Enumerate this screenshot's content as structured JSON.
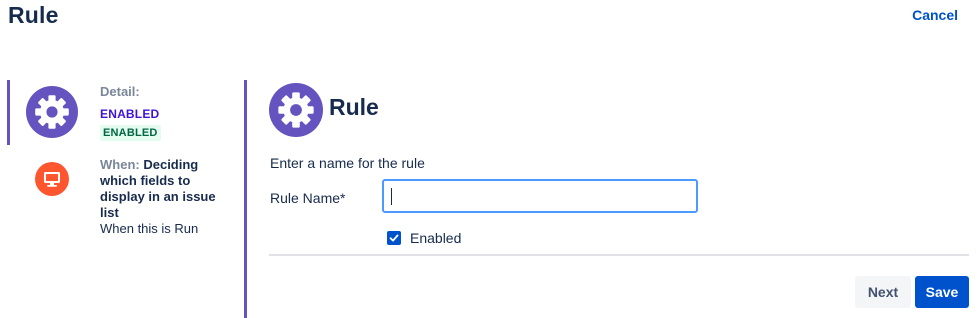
{
  "header": {
    "title": "Rule",
    "cancel_label": "Cancel"
  },
  "sidebar": {
    "detail": {
      "label": "Detail:",
      "status": "ENABLED",
      "lozenge": "ENABLED"
    },
    "when": {
      "label": "When:",
      "title": "Deciding which fields to display in an issue list",
      "subtitle": "When this is Run"
    }
  },
  "main": {
    "title": "Rule",
    "instruction": "Enter a name for the rule",
    "rule_name": {
      "label": "Rule Name*",
      "value": "",
      "placeholder": ""
    },
    "enabled": {
      "label": "Enabled",
      "checked": true
    },
    "buttons": {
      "next": "Next",
      "save": "Save"
    }
  },
  "colors": {
    "accent_purple": "#6554c0",
    "accent_orange": "#ff5630",
    "primary_blue": "#0052cc",
    "success_green": "#006644",
    "focus_blue": "#4c9aff"
  },
  "icons": {
    "detail": "gear-icon",
    "when": "monitor-icon",
    "main": "gear-icon",
    "enabled": "checkmark-icon"
  }
}
